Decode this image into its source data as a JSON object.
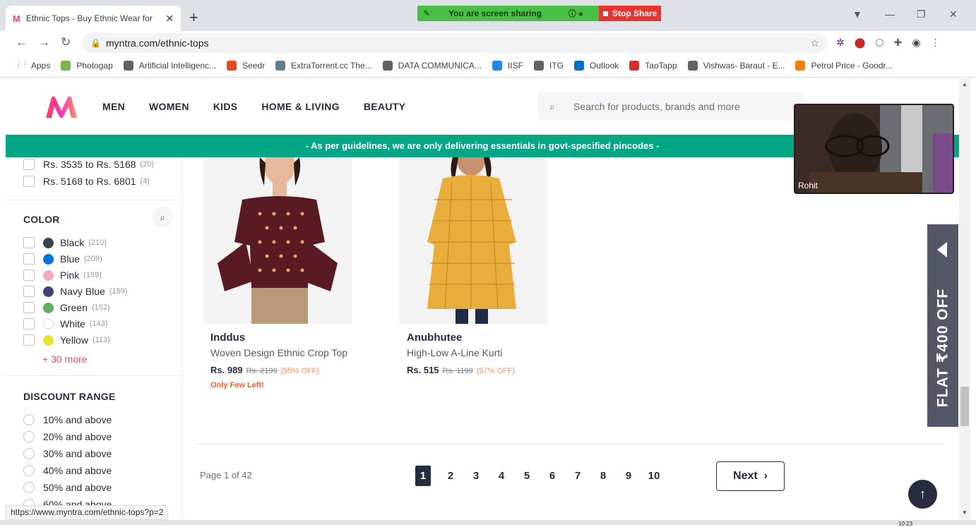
{
  "browser": {
    "tab_title": "Ethnic Tops - Buy Ethnic Wear for",
    "url": "myntra.com/ethnic-tops",
    "share_message": "You are screen sharing",
    "stop_share": "Stop Share",
    "bookmarks": [
      {
        "label": "Apps",
        "color": "#4285f4"
      },
      {
        "label": "Photogap",
        "color": "#7cb342"
      },
      {
        "label": "Artificial Intelligenc...",
        "color": "#5f6368"
      },
      {
        "label": "Seedr",
        "color": "#e64a19"
      },
      {
        "label": "ExtraTorrent.cc The...",
        "color": "#607d8b"
      },
      {
        "label": "DATA COMMUNICA...",
        "color": "#5f6368"
      },
      {
        "label": "IISF",
        "color": "#1e88e5"
      },
      {
        "label": "ITG",
        "color": "#5f6368"
      },
      {
        "label": "Outlook",
        "color": "#0072c6"
      },
      {
        "label": "TaoTapp",
        "color": "#d32f2f"
      },
      {
        "label": "Vishwas- Baraut - E...",
        "color": "#5f6368"
      },
      {
        "label": "Petrol Price - Goodr...",
        "color": "#f57c00"
      }
    ],
    "status_url": "https://www.myntra.com/ethnic-tops?p=2",
    "clock": "10:23"
  },
  "header": {
    "menu": [
      "MEN",
      "WOMEN",
      "KIDS",
      "HOME & LIVING",
      "BEAUTY"
    ],
    "search_placeholder": "Search for products, brands and more"
  },
  "banner": "- As per guidelines, we are only delivering essentials in govt-specified pincodes -",
  "video": {
    "name": "Rohit"
  },
  "filters": {
    "price": [
      {
        "label": "Rs. 3535 to Rs. 5168",
        "count": "(20)"
      },
      {
        "label": "Rs. 5168 to Rs. 6801",
        "count": "(4)"
      }
    ],
    "color_title": "COLOR",
    "colors": [
      {
        "label": "Black",
        "count": "(210)",
        "swatch": "#36454f"
      },
      {
        "label": "Blue",
        "count": "(209)",
        "swatch": "#0074d9"
      },
      {
        "label": "Pink",
        "count": "(159)",
        "swatch": "#f1a9c4"
      },
      {
        "label": "Navy Blue",
        "count": "(159)",
        "swatch": "#3c4477"
      },
      {
        "label": "Green",
        "count": "(152)",
        "swatch": "#5eb160"
      },
      {
        "label": "White",
        "count": "(143)",
        "swatch": "#ffffff"
      },
      {
        "label": "Yellow",
        "count": "(113)",
        "swatch": "#e8e337"
      }
    ],
    "more": "+ 30 more",
    "discount_title": "DISCOUNT RANGE",
    "discounts": [
      "10% and above",
      "20% and above",
      "30% and above",
      "40% and above",
      "50% and above",
      "60% and above"
    ]
  },
  "products": [
    {
      "brand": "Inddus",
      "name": "Woven Design Ethnic Crop Top",
      "price": "Rs. 989",
      "mrp": "Rs. 2199",
      "discount": "(55% OFF)",
      "note": "Only Few Left!"
    },
    {
      "brand": "Anubhutee",
      "name": "High-Low A-Line Kurti",
      "price": "Rs. 515",
      "mrp": "Rs. 1199",
      "discount": "(57% OFF)",
      "note": ""
    }
  ],
  "pagination": {
    "info": "Page 1 of 42",
    "pages": [
      "1",
      "2",
      "3",
      "4",
      "5",
      "6",
      "7",
      "8",
      "9",
      "10"
    ],
    "next": "Next"
  },
  "promo": "FLAT ₹400 OFF"
}
